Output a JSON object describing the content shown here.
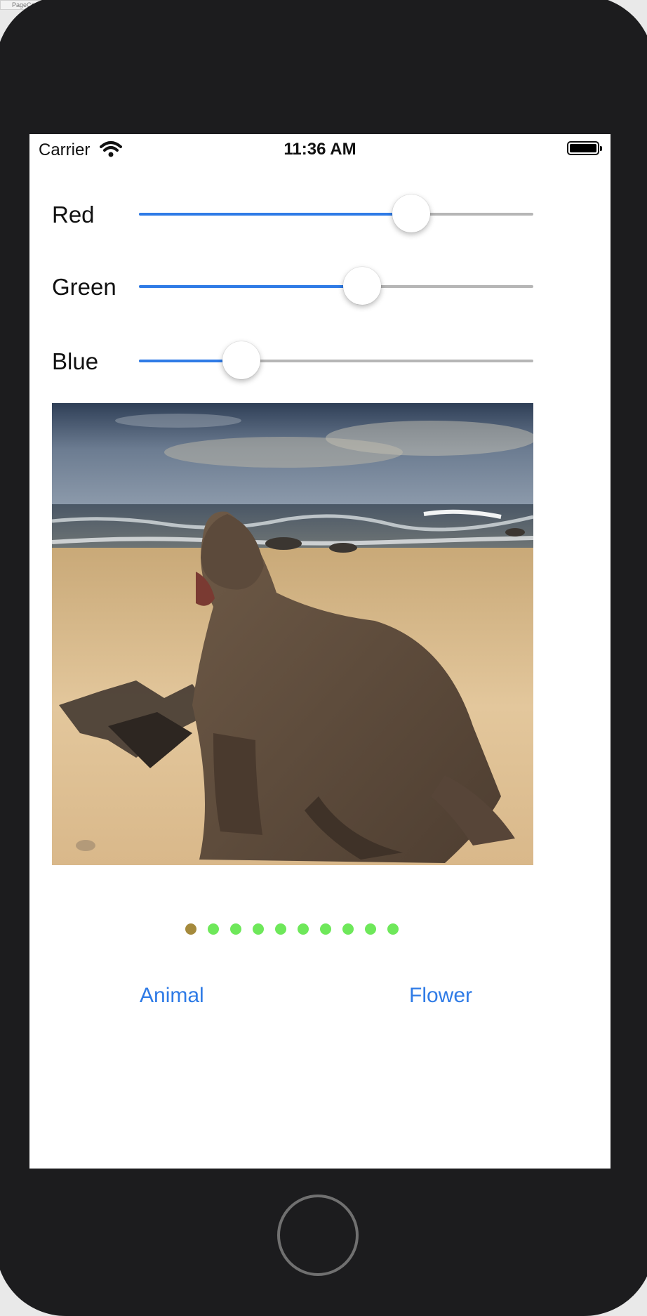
{
  "simulator": {
    "corner_label": "PageCo"
  },
  "status_bar": {
    "carrier": "Carrier",
    "time": "11:36 AM",
    "wifi_icon": "wifi-icon",
    "battery_icon": "battery-icon"
  },
  "sliders": [
    {
      "label": "Red",
      "value": 0.69
    },
    {
      "label": "Green",
      "value": 0.565
    },
    {
      "label": "Blue",
      "value": 0.26
    }
  ],
  "slider_colors": {
    "filled": "#2f7be6",
    "empty": "#b6b6b6"
  },
  "image": {
    "subject": "sea-lion-on-beach"
  },
  "page_control": {
    "count": 10,
    "current": 0,
    "current_color": "#a58a3c",
    "other_color": "#6ee85a"
  },
  "buttons": {
    "animal": "Animal",
    "flower": "Flower"
  },
  "accent_color": "#2f7be6"
}
